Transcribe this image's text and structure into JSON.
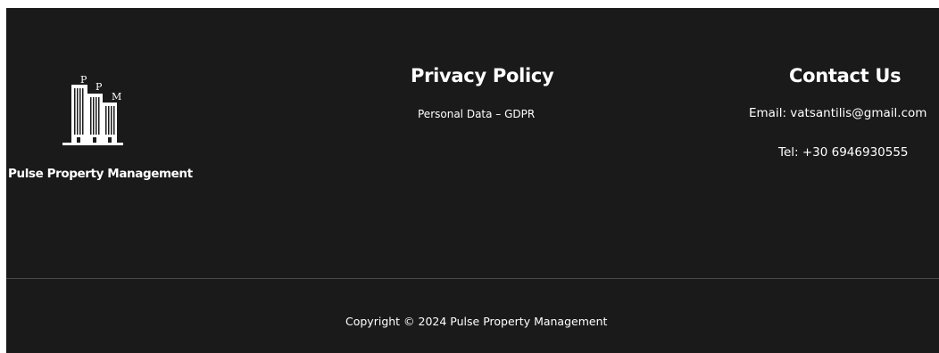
{
  "brand": {
    "logo_letters": [
      "P",
      "P",
      "M"
    ],
    "name": "Pulse Property Management"
  },
  "privacy": {
    "heading": "Privacy Policy",
    "gdpr_link": "Personal Data – GDPR"
  },
  "contact": {
    "heading": "Contact Us",
    "email": "Email: vatsantilis@gmail.com",
    "tel": "Tel: +30 6946930555"
  },
  "copyright": "Copyright © 2024 Pulse Property Management",
  "colors": {
    "background": "#1a1a1a",
    "text": "#ffffff",
    "divider": "#4a4a4a"
  }
}
